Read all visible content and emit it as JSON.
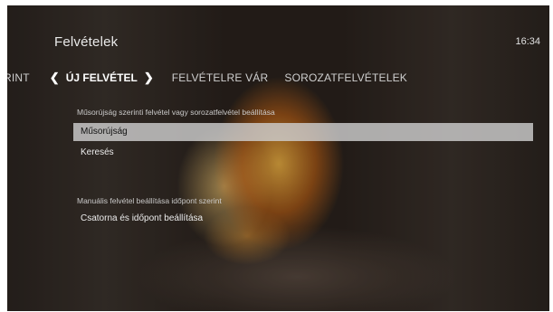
{
  "header": {
    "title": "Felvételek",
    "clock": "16:34"
  },
  "tabs": {
    "prev_partial": "RINT",
    "active": "ÚJ FELVÉTEL",
    "items": [
      "FELVÉTELRE VÁR",
      "SOROZATFELVÉTELEK"
    ]
  },
  "sections": [
    {
      "label": "Műsorújság szerinti felvétel vagy sorozatfelvétel beállítása",
      "items": [
        "Műsorújság",
        "Keresés"
      ]
    },
    {
      "label": "Manuális felvétel beállítása időpont szerint",
      "items": [
        "Csatorna és időpont beállítása"
      ]
    }
  ],
  "selected_item": "Műsorújság"
}
